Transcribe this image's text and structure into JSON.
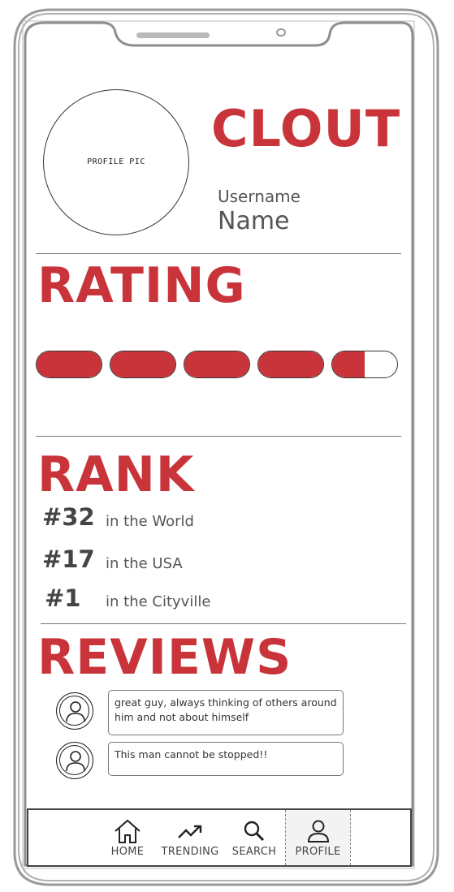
{
  "app": {
    "title": "CLOUT"
  },
  "profile": {
    "pic_label": "PROFILE PIC",
    "username_label": "Username",
    "name": "Name"
  },
  "rating": {
    "title": "RATING",
    "value": 4.5,
    "max": 5
  },
  "rank": {
    "title": "RANK",
    "items": [
      {
        "number": "#32",
        "label": "in the World"
      },
      {
        "number": "#17",
        "label": "in the USA"
      },
      {
        "number": "#1",
        "label": "in the Cityville"
      }
    ]
  },
  "reviews": {
    "title": "REVIEWS",
    "items": [
      {
        "text": "great guy, always thinking of others around him and not about himself"
      },
      {
        "text": "This man cannot be stopped!!"
      }
    ]
  },
  "nav": {
    "items": [
      {
        "label": "HOME",
        "icon": "home-icon"
      },
      {
        "label": "TRENDING",
        "icon": "trending-icon"
      },
      {
        "label": "SEARCH",
        "icon": "search-icon"
      },
      {
        "label": "PROFILE",
        "icon": "profile-icon",
        "active": true
      }
    ]
  },
  "colors": {
    "accent": "#c9343a",
    "text": "#444444",
    "frame": "#9a9a9a"
  }
}
